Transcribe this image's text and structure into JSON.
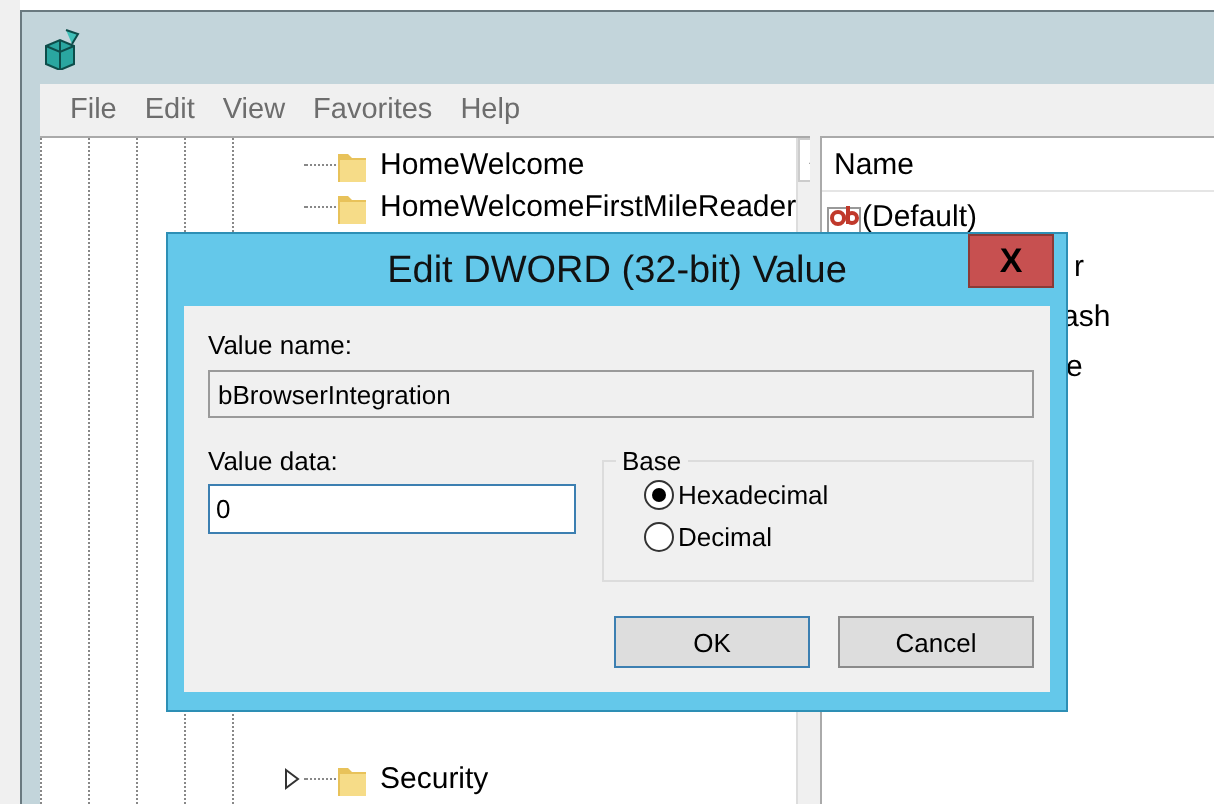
{
  "window": {
    "menu": [
      "File",
      "Edit",
      "View",
      "Favorites",
      "Help"
    ]
  },
  "tree": {
    "items": [
      {
        "label": "HomeWelcome",
        "expandable": false
      },
      {
        "label": "HomeWelcomeFirstMileReader",
        "expandable": false
      },
      {
        "label": "Security",
        "expandable": true
      }
    ]
  },
  "values_list": {
    "column": "Name",
    "rows": [
      {
        "name": "(Default)",
        "kind": "string"
      },
      {
        "name": "r",
        "kind": "partial"
      },
      {
        "name": "ash",
        "kind": "partial"
      },
      {
        "name": "e",
        "kind": "partial"
      }
    ]
  },
  "dialog": {
    "title": "Edit DWORD (32-bit) Value",
    "close": "X",
    "value_name_label": "Value name:",
    "value_name": "bBrowserIntegration",
    "value_data_label": "Value data:",
    "value_data": "0",
    "base": {
      "label": "Base",
      "options": [
        {
          "label": "Hexadecimal",
          "selected": true
        },
        {
          "label": "Decimal",
          "selected": false
        }
      ]
    },
    "buttons": [
      {
        "label": "OK",
        "default": true
      },
      {
        "label": "Cancel",
        "default": false
      }
    ]
  }
}
